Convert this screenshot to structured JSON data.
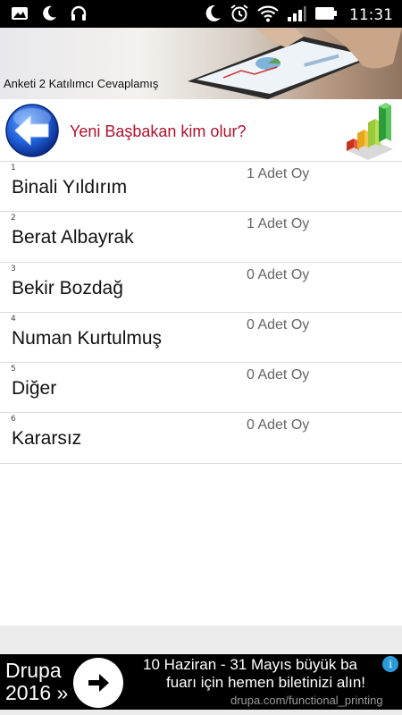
{
  "status_bar": {
    "time": "11:31",
    "left_icons": [
      "image-icon",
      "moon-icon",
      "headphones-icon"
    ],
    "right_icons": [
      "moon-icon",
      "alarm-icon",
      "wifi-icon",
      "signal-icon",
      "battery-icon"
    ]
  },
  "banner": {
    "caption": "Anketi  2 Katılımcı Cevaplamış"
  },
  "header": {
    "title": "Yeni Başbakan kim olur?",
    "back_icon": "back-arrow-icon",
    "chart_icon": "bar-chart-icon"
  },
  "options": [
    {
      "num": "1",
      "name": "Binali Yıldırım",
      "votes": "1 Adet Oy"
    },
    {
      "num": "2",
      "name": "Berat Albayrak",
      "votes": "1 Adet Oy"
    },
    {
      "num": "3",
      "name": "Bekir Bozdağ",
      "votes": "0 Adet Oy"
    },
    {
      "num": "4",
      "name": "Numan Kurtulmuş",
      "votes": "0 Adet Oy"
    },
    {
      "num": "5",
      "name": "Diğer",
      "votes": "0 Adet Oy"
    },
    {
      "num": "6",
      "name": "Kararsız",
      "votes": "0 Adet Oy"
    }
  ],
  "ad": {
    "brand_line1": "Drupa",
    "brand_line2": "2016 »",
    "line1": "10 Haziran - 31 Mayıs büyük ba",
    "line2": "fuarı için hemen biletinizi alın!",
    "url": "drupa.com/functional_printing",
    "info_glyph": "i",
    "arrow_glyph": "➜"
  }
}
